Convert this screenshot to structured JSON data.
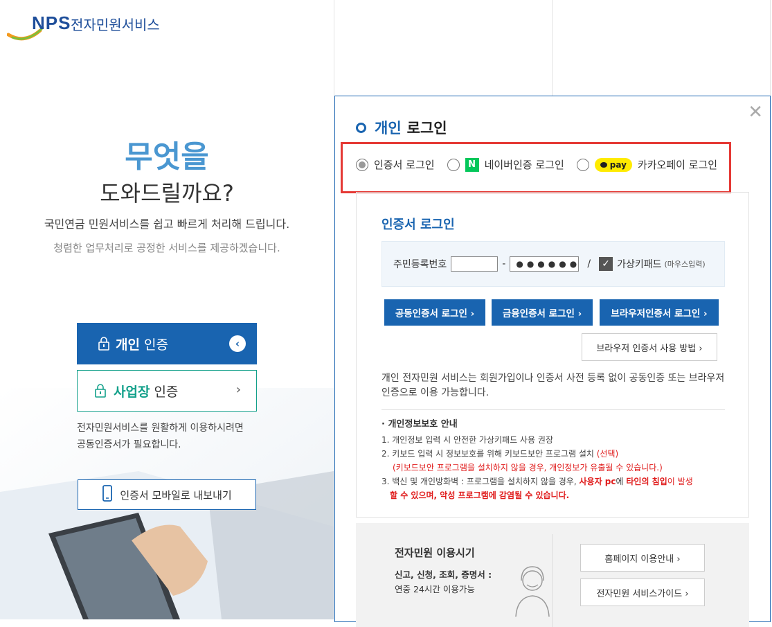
{
  "header": {
    "logo_brand": "NPS",
    "logo_service": "전자민원서비스"
  },
  "hero": {
    "line1": "무엇을",
    "line2": "도와드릴까요?",
    "line3": "국민연금 민원서비스를 쉽고 빠르게 처리해 드립니다.",
    "line4": "청렴한 업무처리로 공정한 서비스를 제공하겠습니다."
  },
  "auth_buttons": {
    "personal_bold": "개인",
    "personal_rest": "인증",
    "business_bold": "사업장",
    "business_rest": "인증"
  },
  "left_note": {
    "line1": "전자민원서비스를 원활하게 이용하시려면",
    "line2": "공동인증서가 필요합니다."
  },
  "mobile_export": "인증서 모바일로 내보내기",
  "modal": {
    "title_blue": "개인",
    "title_rest": "로그인",
    "login_methods": [
      {
        "label": "인증서 로그인",
        "selected": true
      },
      {
        "label": "네이버인증 로그인",
        "badge": "N",
        "selected": false
      },
      {
        "label": "카카오페이 로그인",
        "badge": "pay",
        "selected": false
      }
    ],
    "cert_title": "인증서 로그인",
    "rrn_label": "주민등록번호",
    "rrn_dash": "-",
    "rrn_masked": "●●●●●●",
    "rrn_slash": "/",
    "vkeypad_label": "가상키패드",
    "vkeypad_sub": "(마우스입력)",
    "buttons": [
      "공동인증서 로그인 ›",
      "금융인증서 로그인 ›",
      "브라우저인증서 로그인 ›"
    ],
    "how_to": "브라우저 인증서 사용 방법 ›",
    "description": "개인 전자민원 서비스는 회원가입이나 인증서 사전 등록 없이 공동인증 또는 브라우저인증으로 이용 가능합니다.",
    "privacy": {
      "heading": "· 개인정보보호 안내",
      "item1": "1. 개인정보 입력 시 안전한 가상키패드 사용 권장",
      "item2_a": "2. 키보드 입력 시 정보보호를 위해 키보드보안 프로그램 설치 ",
      "item2_b": "(선택)",
      "item2_c": "(키보드보안 프로그램을 설치하지 않을 경우, 개인정보가 유출될 수 있습니다.)",
      "item3_a": "3. 백신 및 개인방화벽 : 프로그램을 설치하지 않을 경우, ",
      "item3_b": "사용자 pc",
      "item3_c": "에 ",
      "item3_d": "타인의 침입",
      "item3_e": "이 발생",
      "item3_f": "할 수 있으며, 악성 프로그램에 감염될 수 있습니다."
    },
    "bottom": {
      "title": "전자민원 이용시기",
      "sub1": "신고, 신청, 조회, 증명서 :",
      "sub2": "연중 24시간 이용가능",
      "btn_home": "홈페이지 이용안내 ›",
      "btn_guide": "전자민원 서비스가이드 ›"
    }
  },
  "colors": {
    "primary": "#1964b0",
    "teal": "#12a08a",
    "naver": "#03c75a",
    "kakao": "#ffeb00",
    "highlight": "#e53935"
  }
}
